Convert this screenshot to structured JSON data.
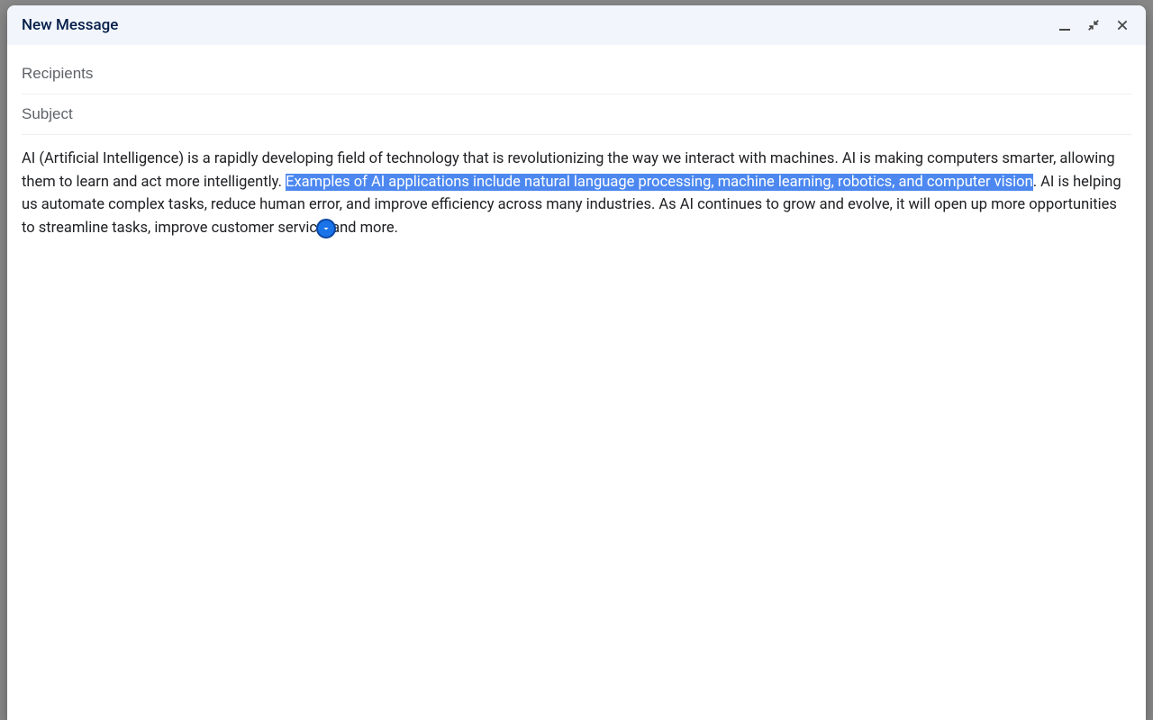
{
  "header": {
    "title": "New Message"
  },
  "fields": {
    "recipients_placeholder": "Recipients",
    "recipients_value": "",
    "subject_placeholder": "Subject",
    "subject_value": ""
  },
  "body": {
    "part1": "AI (Artificial Intelligence) is a rapidly developing field of technology that is revolutionizing the way we interact with machines. AI is making computers smarter, allowing them to learn and act more intelligently. ",
    "highlighted": "Examples of AI applications include natural language processing, machine learning, robotics, and computer vision",
    "part2": ". AI is helping us automate complex tasks, reduce human error, and improve efficiency across many industries. As AI continues to grow and evolve, it will open up more opportunities to streamline tasks, improve customer service, and more."
  }
}
